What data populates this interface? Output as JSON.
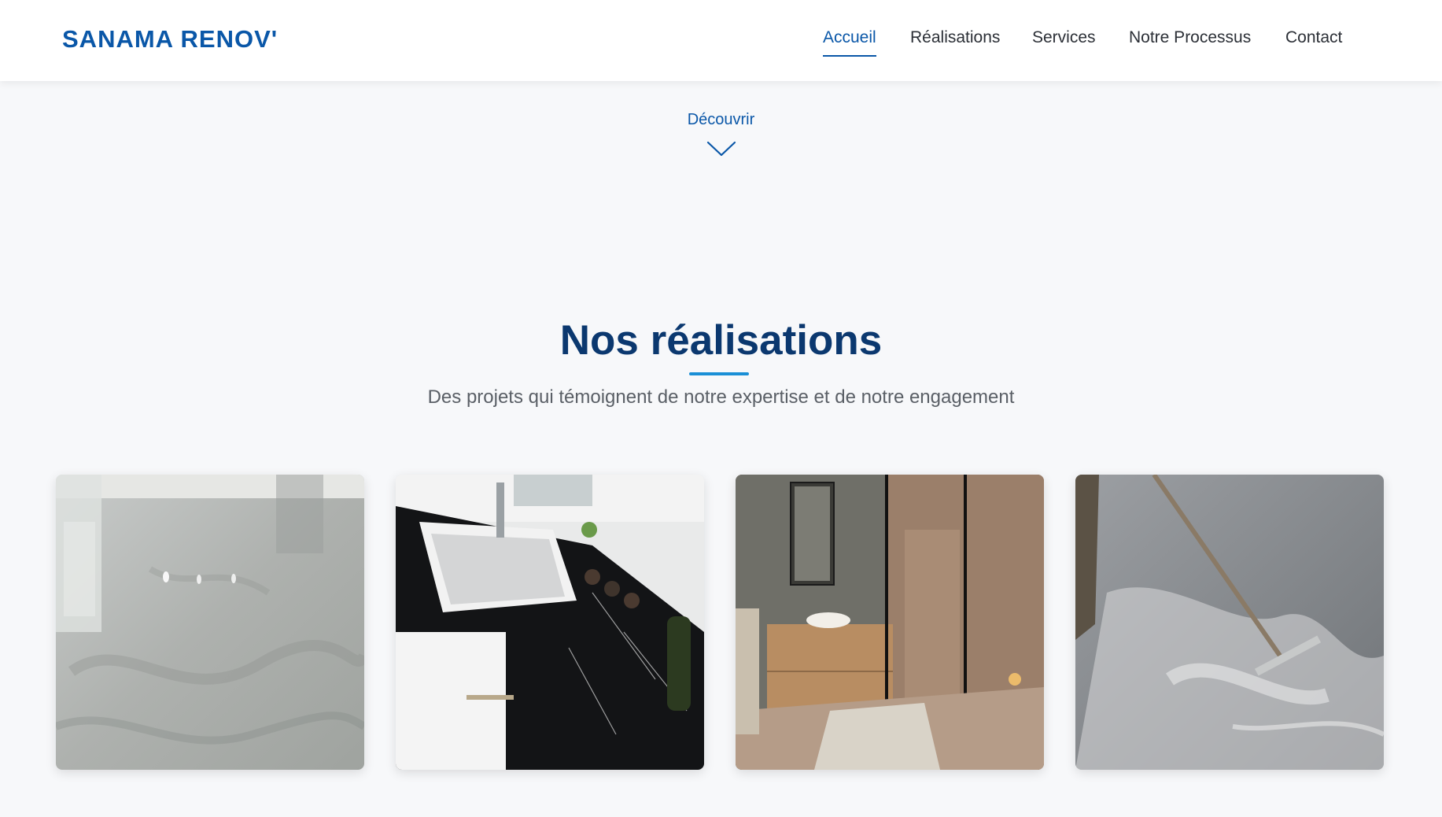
{
  "header": {
    "logo": "SANAMA RENOV'",
    "nav": [
      {
        "label": "Accueil",
        "active": true
      },
      {
        "label": "Réalisations",
        "active": false
      },
      {
        "label": "Services",
        "active": false
      },
      {
        "label": "Notre Processus",
        "active": false
      },
      {
        "label": "Contact",
        "active": false
      }
    ]
  },
  "hero": {
    "discover_label": "Découvrir",
    "discover_icon": "chevron-down-icon"
  },
  "realisations": {
    "title": "Nos réalisations",
    "subtitle": "Des projets qui témoignent de notre expertise et de notre engagement",
    "projects": [
      {
        "subject": "marble-epoxy-floor"
      },
      {
        "subject": "kitchen-sink-black-marble-counter"
      },
      {
        "subject": "bathroom-wood-vanity-glass-shower"
      },
      {
        "subject": "resin-floor-squeegee-application"
      }
    ]
  },
  "colors": {
    "brand": "#0a57a8",
    "title": "#0b386f",
    "accent_line": "#1a8fd6",
    "background": "#f7f8fa"
  }
}
